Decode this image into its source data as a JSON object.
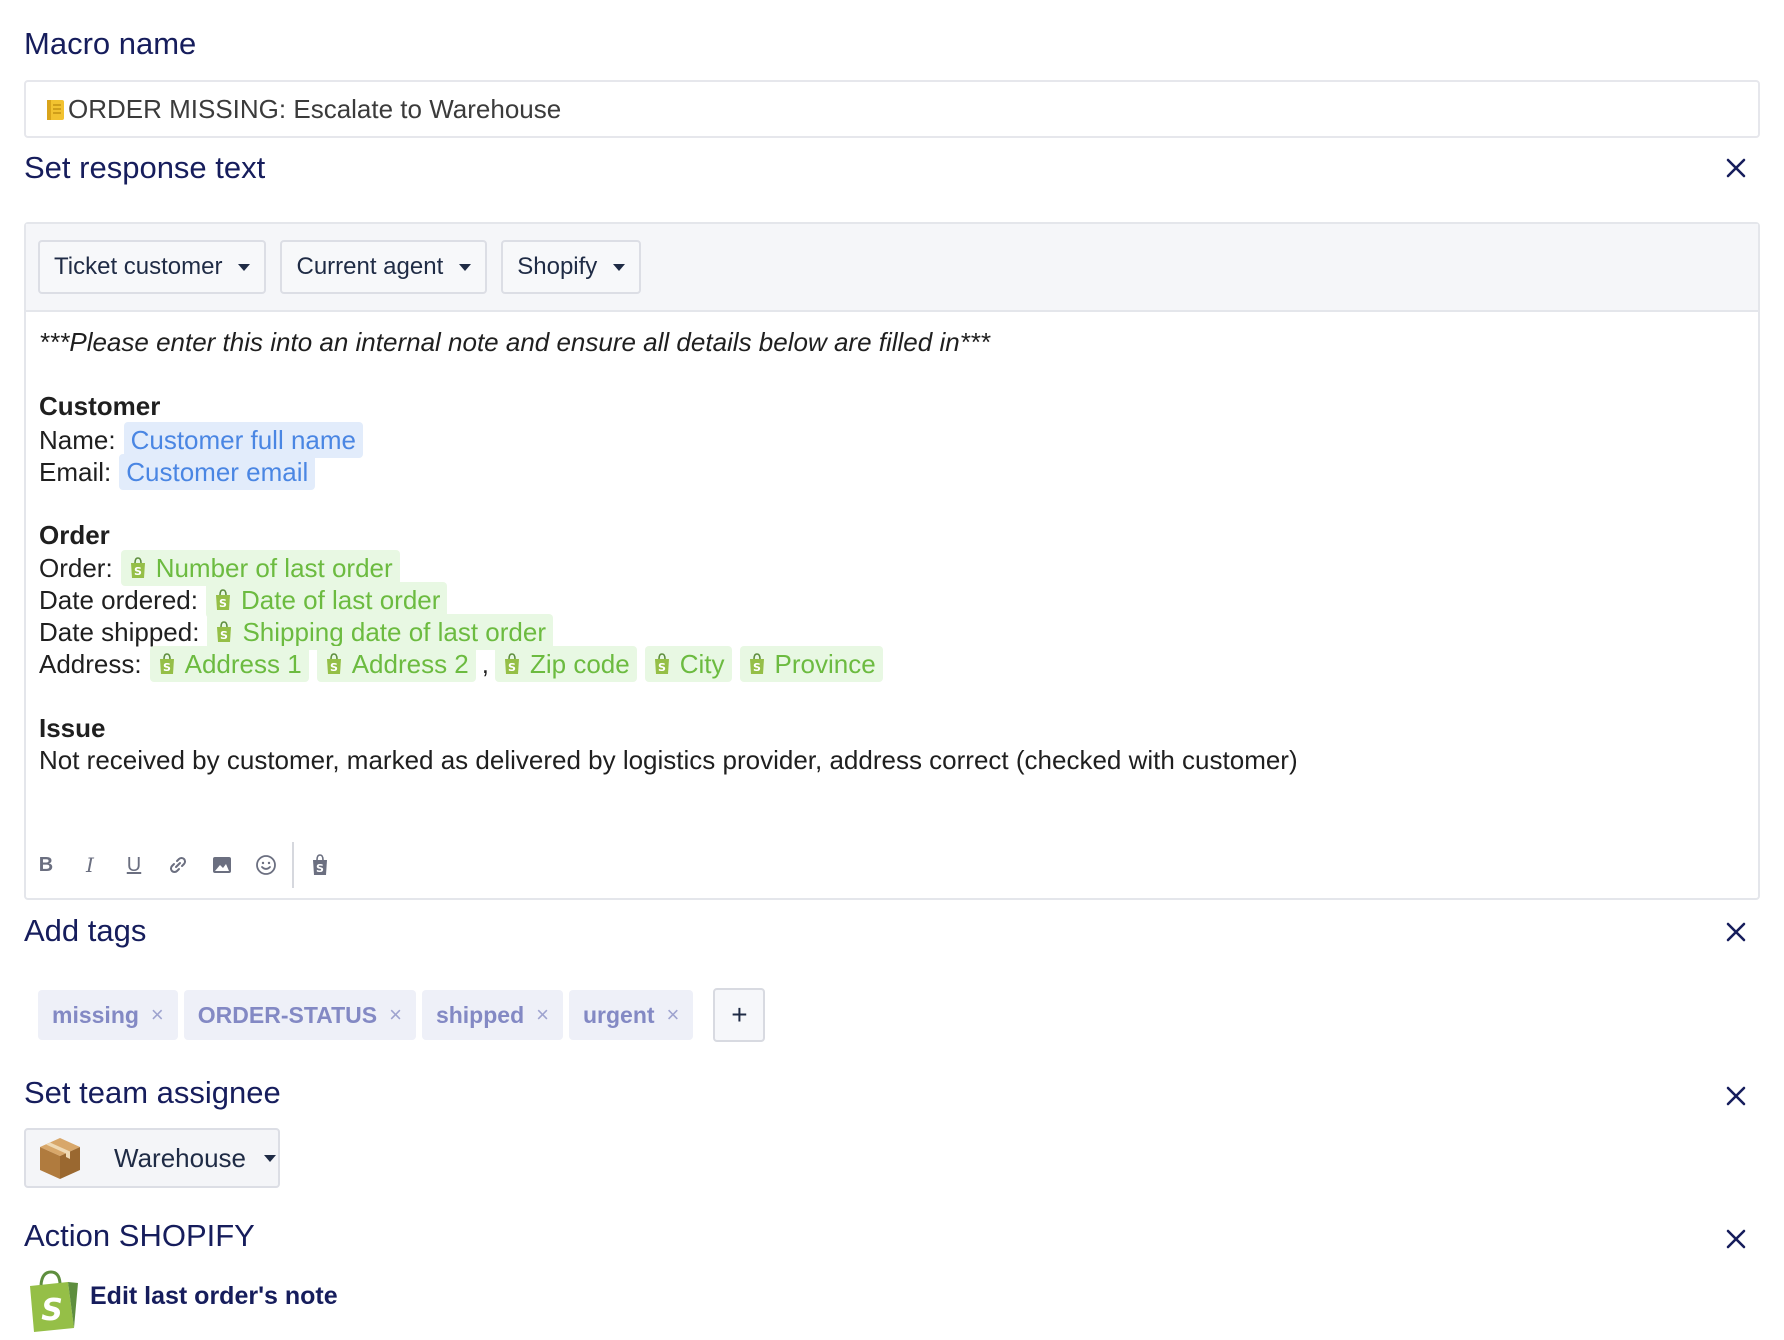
{
  "macro": {
    "section_title": "Macro name",
    "name_value": "ORDER MISSING: Escalate to Warehouse",
    "name_icon": "notebook-icon"
  },
  "response": {
    "section_title": "Set response text",
    "toolbar": {
      "dropdowns": [
        "Ticket customer",
        "Current agent",
        "Shopify"
      ]
    },
    "body": {
      "intro": "***Please enter this into an internal note and ensure all details below are filled in***",
      "customer_heading": "Customer",
      "name_label": "Name:",
      "name_var": "Customer full name",
      "email_label": "Email:",
      "email_var": "Customer email",
      "order_heading": "Order",
      "order_label": "Order:",
      "order_var": "Number of last order",
      "date_ordered_label": "Date ordered:",
      "date_ordered_var": "Date of last order",
      "date_shipped_label": "Date shipped:",
      "date_shipped_var": "Shipping date of last order",
      "address_label": "Address:",
      "address_vars": [
        "Address 1",
        "Address 2",
        "Zip code",
        "City",
        "Province"
      ],
      "address_sep": ",",
      "issue_heading": "Issue",
      "issue_text": "Not received by customer, marked as delivered by logistics provider, address correct (checked with customer)"
    },
    "format_bar": {
      "bold": "B",
      "italic": "I",
      "underline": "U"
    }
  },
  "tags": {
    "section_title": "Add tags",
    "items": [
      "missing",
      "ORDER-STATUS",
      "shipped",
      "urgent"
    ],
    "remove_glyph": "×",
    "add_glyph": "+"
  },
  "team": {
    "section_title": "Set team assignee",
    "assignee": "Warehouse"
  },
  "action": {
    "section_title": "Action SHOPIFY",
    "label": "Edit last order's note"
  },
  "colors": {
    "title": "#161d5c",
    "chip_blue_bg": "#e2ecfb",
    "chip_blue_fg": "#4a86e3",
    "chip_green_bg": "#e8f8e3",
    "chip_green_fg": "#6cbb40",
    "tag_fg": "#8389c4"
  }
}
